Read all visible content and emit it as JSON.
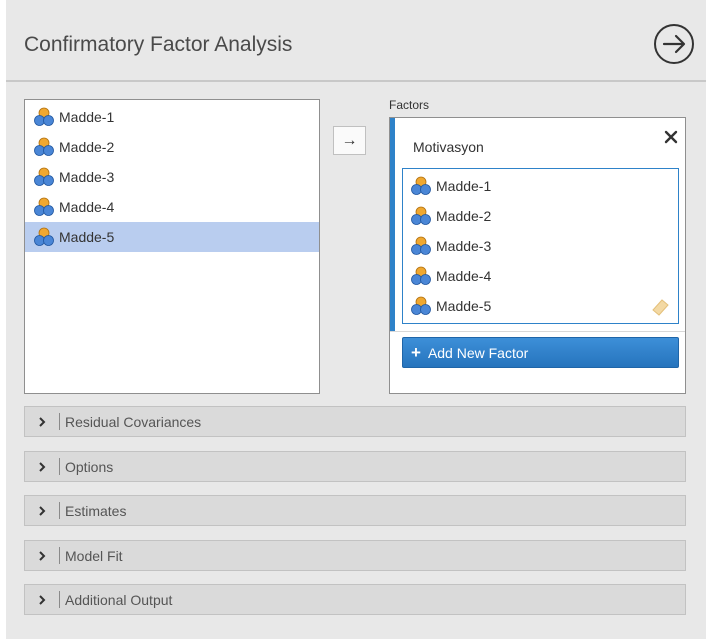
{
  "header": {
    "title": "Confirmatory Factor Analysis"
  },
  "variables": {
    "items": [
      {
        "label": "Madde-1",
        "selected": false
      },
      {
        "label": "Madde-2",
        "selected": false
      },
      {
        "label": "Madde-3",
        "selected": false
      },
      {
        "label": "Madde-4",
        "selected": false
      },
      {
        "label": "Madde-5",
        "selected": true
      }
    ]
  },
  "move_button": {
    "label": "→"
  },
  "factors": {
    "label": "Factors",
    "factor": {
      "name": "Motivasyon",
      "close_label": "×",
      "items": [
        {
          "label": "Madde-1"
        },
        {
          "label": "Madde-2"
        },
        {
          "label": "Madde-3"
        },
        {
          "label": "Madde-4"
        },
        {
          "label": "Madde-5"
        }
      ]
    },
    "add_button": {
      "plus": "+",
      "label": "Add New Factor"
    }
  },
  "sections": [
    {
      "chevron": "›",
      "label": "Residual Covariances"
    },
    {
      "chevron": "›",
      "label": "Options"
    },
    {
      "chevron": "›",
      "label": "Estimates"
    },
    {
      "chevron": "›",
      "label": "Model Fit"
    },
    {
      "chevron": "›",
      "label": "Additional Output"
    }
  ],
  "colors": {
    "accent": "#2e82c9",
    "selection": "#b9cdef",
    "background": "#e8e8e8"
  },
  "icons": {
    "variable": "nominal-variable-icon",
    "run": "arrow-circle-right-icon",
    "close": "close-icon",
    "tag": "tag-icon",
    "chevron": "chevron-right-icon"
  }
}
